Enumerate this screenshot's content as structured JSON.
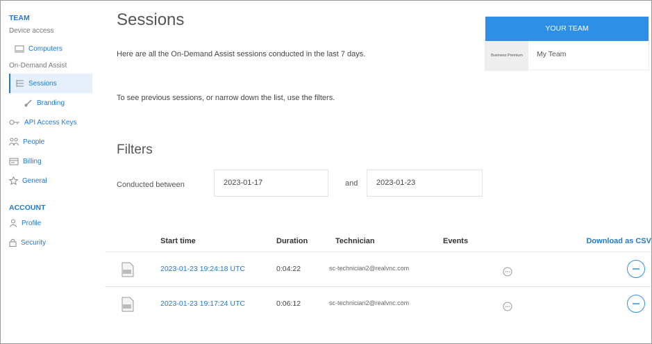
{
  "sidebar": {
    "team_section": "TEAM",
    "device_access_group": "Device access",
    "computers": "Computers",
    "on_demand_group": "On-Demand Assist",
    "sessions": "Sessions",
    "branding": "Branding",
    "api_keys": "API Access Keys",
    "people": "People",
    "billing": "Billing",
    "general": "General",
    "account_section": "ACCOUNT",
    "profile": "Profile",
    "security": "Security"
  },
  "main": {
    "title": "Sessions",
    "desc1": "Here are all the On-Demand Assist sessions conducted in the last 7 days.",
    "desc2": "To see previous sessions, or narrow down the list, use the filters.",
    "filters_title": "Filters",
    "filter_label": "Conducted between",
    "date_from": "2023-01-17",
    "and_label": "and",
    "date_to": "2023-01-23"
  },
  "team": {
    "header": "YOUR TEAM",
    "plan": "Business Premium",
    "name": "My Team"
  },
  "table": {
    "headers": {
      "start": "Start time",
      "duration": "Duration",
      "technician": "Technician",
      "events": "Events"
    },
    "download": "Download as CSV",
    "rows": [
      {
        "start": "2023-01-23 19:24:18 UTC",
        "duration": "0:04:22",
        "technician": "sc-technician2@realvnc.com"
      },
      {
        "start": "2023-01-23 19:17:24 UTC",
        "duration": "0:06:12",
        "technician": "sc-technician2@realvnc.com"
      }
    ]
  },
  "colors": {
    "accent": "#1f78d1",
    "team_header": "#2d8fe6",
    "active_bg": "#e6f0fa"
  },
  "icons": [
    "monitor-icon",
    "list-icon",
    "brush-icon",
    "key-icon",
    "people-icon",
    "billing-icon",
    "star-icon",
    "person-icon",
    "lock-icon",
    "file-icon",
    "chat-icon",
    "ellipsis-icon"
  ]
}
